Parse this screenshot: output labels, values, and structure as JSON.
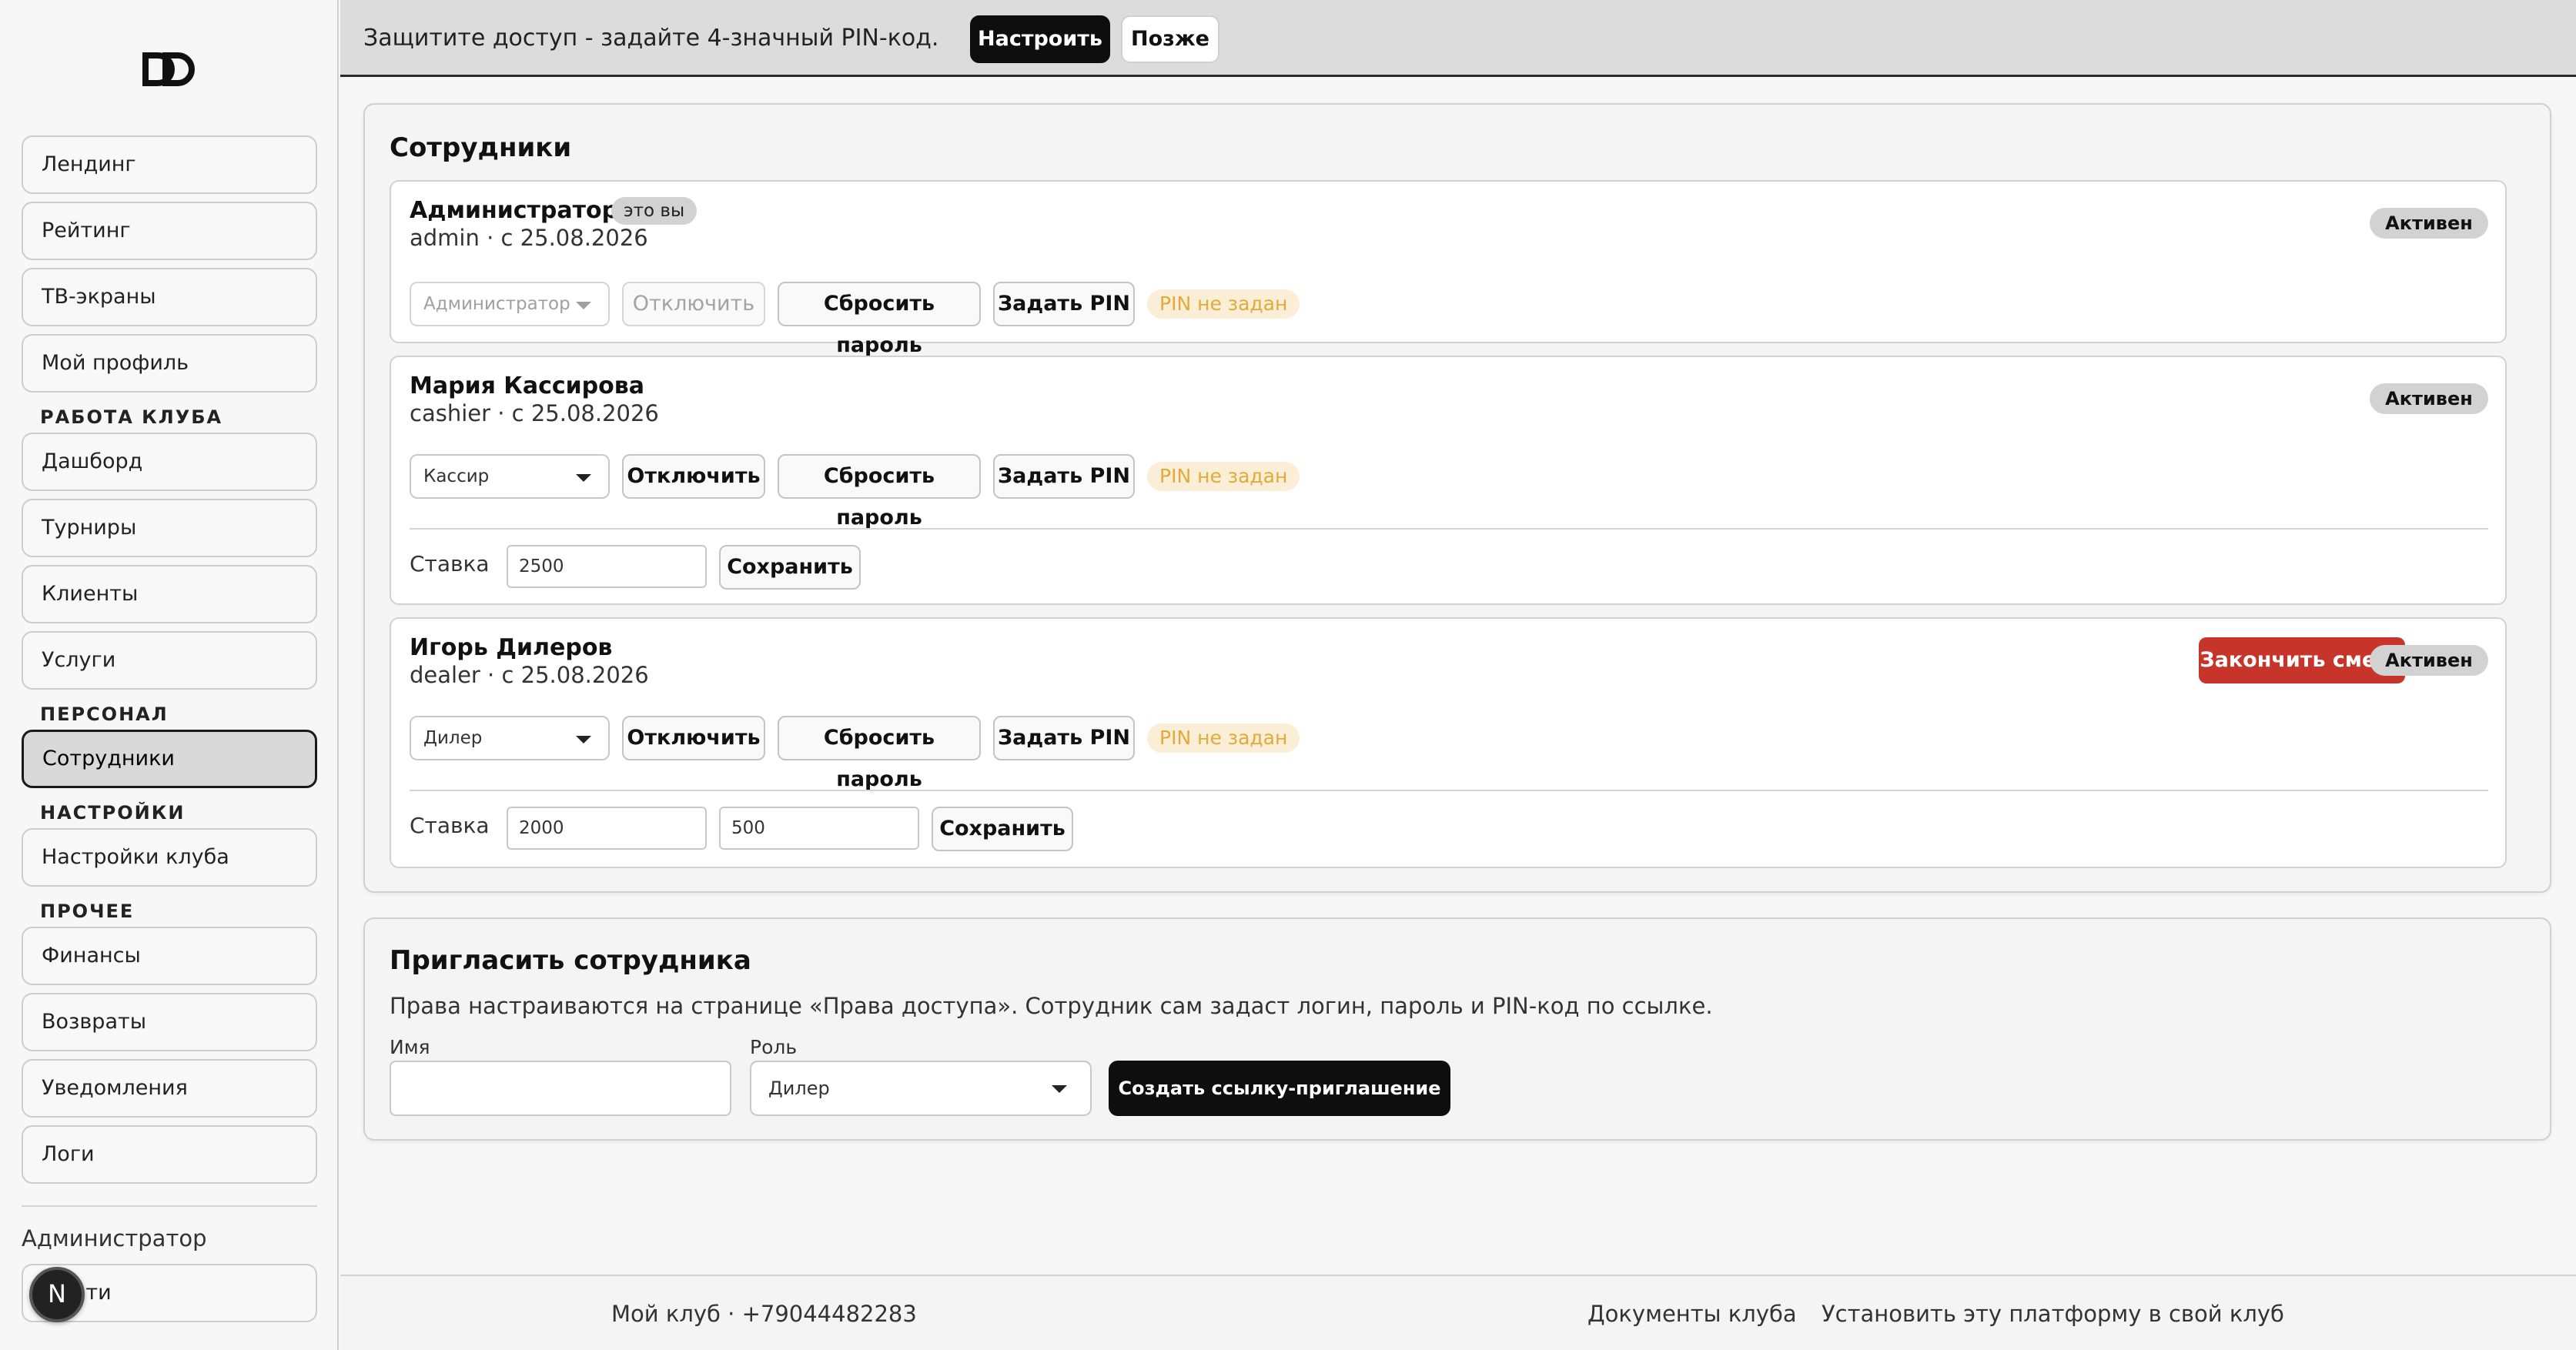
{
  "logo_text": "DD",
  "sidebar": {
    "items_top": [
      "Лендинг",
      "Рейтинг",
      "ТВ-экраны",
      "Мой профиль"
    ],
    "section_club": "РАБОТА КЛУБА",
    "items_club": [
      "Дашборд",
      "Турниры",
      "Клиенты",
      "Услуги"
    ],
    "section_staff": "ПЕРСОНАЛ",
    "item_staff": "Сотрудники",
    "section_settings": "НАСТРОЙКИ",
    "item_settings": "Настройки клуба",
    "section_other": "ПРОЧЕЕ",
    "items_other": [
      "Финансы",
      "Возвраты",
      "Уведомления",
      "Логи"
    ],
    "user_role": "Администратор",
    "logout_label": "Выйти",
    "avatar_letter": "N"
  },
  "banner": {
    "text": "Защитите доступ - задайте 4-значный PIN-код.",
    "setup_label": "Настроить",
    "later_label": "Позже"
  },
  "employees_card": {
    "title": "Сотрудники",
    "employees": [
      {
        "name": "Администратор",
        "you_badge": "это вы",
        "sub": "admin · с 25.08.2026",
        "status": "Активен",
        "role_select": "Администратор",
        "disable_label": "Отключить",
        "reset_label": "Сбросить пароль",
        "pin_label": "Задать PIN",
        "pin_status": "PIN не задан"
      },
      {
        "name": "Мария Кассирова",
        "sub": "cashier · с 25.08.2026",
        "status": "Активен",
        "role_select": "Кассир",
        "disable_label": "Отключить",
        "reset_label": "Сбросить пароль",
        "pin_label": "Задать PIN",
        "pin_status": "PIN не задан",
        "rate_label": "Ставка",
        "rate_value": "2500",
        "save_label": "Сохранить"
      },
      {
        "name": "Игорь Дилеров",
        "sub": "dealer · с 25.08.2026",
        "status": "Активен",
        "end_shift_label": "Закончить смену",
        "role_select": "Дилер",
        "disable_label": "Отключить",
        "reset_label": "Сбросить пароль",
        "pin_label": "Задать PIN",
        "pin_status": "PIN не задан",
        "rate_label": "Ставка",
        "rate_value": "2000",
        "rate_value_2": "500",
        "save_label": "Сохранить"
      }
    ]
  },
  "invite_card": {
    "title": "Пригласить сотрудника",
    "description": "Права настраиваются на странице «Права доступа». Сотрудник сам задаст логин, пароль и PIN-код по ссылке.",
    "name_label": "Имя",
    "name_value": "",
    "role_label": "Роль",
    "role_value": "Дилер",
    "create_label": "Создать ссылку-приглашение"
  },
  "footer": {
    "club_info": "Мой клуб · +79044482283",
    "docs_link": "Документы клуба",
    "install_link": "Установить эту платформу в свой клуб"
  },
  "colors": {
    "accent_dark": "#0e0e0e",
    "danger": "#c7342a",
    "pin_warning": "#e3a93a",
    "status_bg": "#d2d2d2"
  }
}
